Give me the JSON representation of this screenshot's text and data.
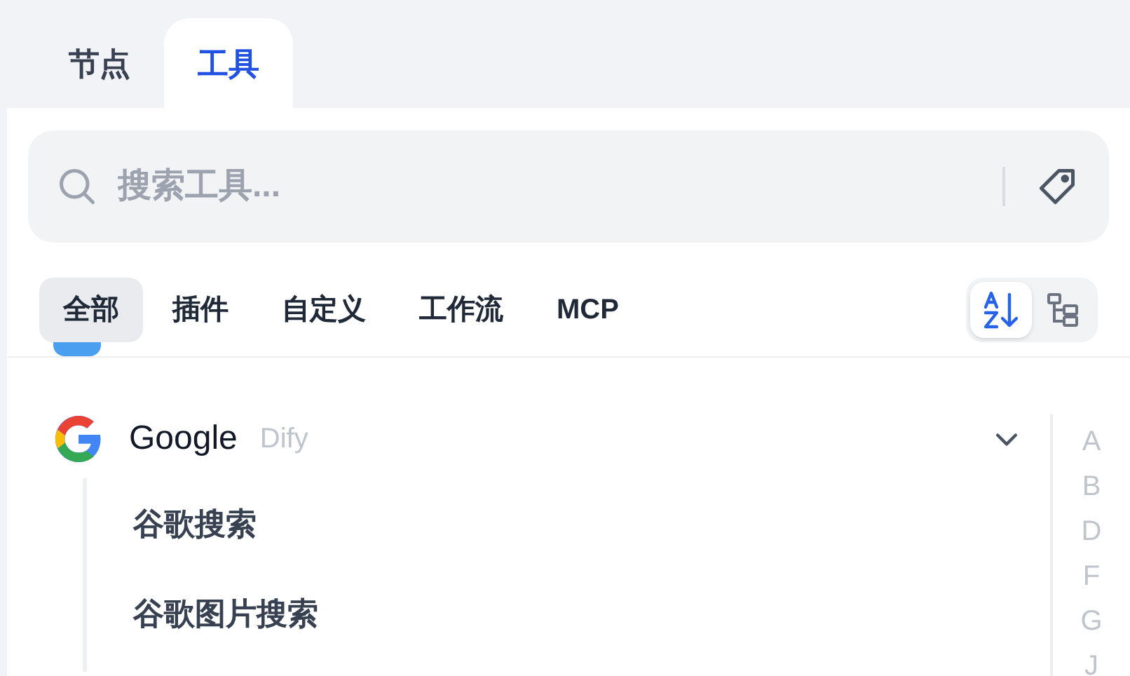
{
  "tabs": [
    {
      "label": "节点",
      "selected": false
    },
    {
      "label": "工具",
      "selected": true
    }
  ],
  "search": {
    "placeholder": "搜索工具..."
  },
  "filters": [
    {
      "label": "全部",
      "selected": true
    },
    {
      "label": "插件",
      "selected": false
    },
    {
      "label": "自定义",
      "selected": false
    },
    {
      "label": "工作流",
      "selected": false
    },
    {
      "label": "MCP",
      "selected": false
    }
  ],
  "view_modes": [
    {
      "kind": "alphabetical",
      "selected": true
    },
    {
      "kind": "tree",
      "selected": false
    }
  ],
  "providers": [
    {
      "name": "Google",
      "author": "Dify",
      "expanded": true,
      "tools": [
        {
          "name": "谷歌搜索"
        },
        {
          "name": "谷歌图片搜索"
        }
      ]
    }
  ],
  "index_letters": [
    "A",
    "B",
    "D",
    "F",
    "G",
    "J"
  ]
}
